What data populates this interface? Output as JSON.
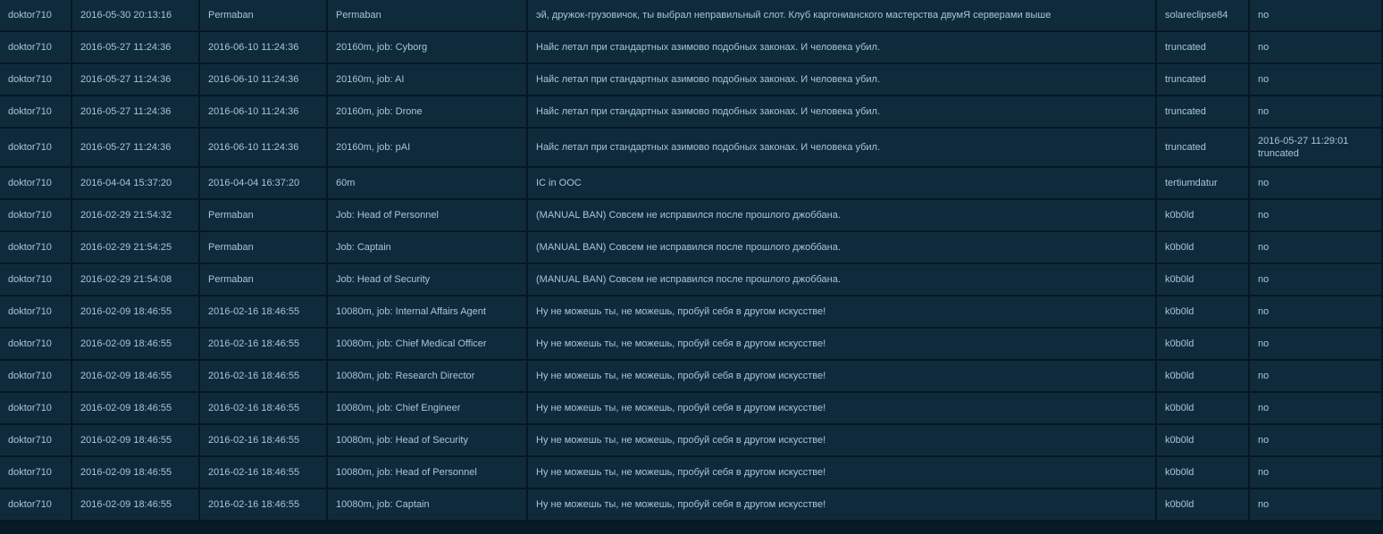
{
  "rows": [
    {
      "ckey": "doktor710",
      "bantime": "2016-05-30 20:13:16",
      "expires": "Permaban",
      "type": "Permaban",
      "reason": "эй, дружок-грузовичок, ты выбрал неправильный слот. Клуб каргонианского мастерства двумЯ серверами выше",
      "admin": "solareclipse84",
      "unbanned": "no"
    },
    {
      "ckey": "doktor710",
      "bantime": "2016-05-27 11:24:36",
      "expires": "2016-06-10 11:24:36",
      "type": "20160m, job: Cyborg",
      "reason": "Найс летал при стандартных азимово подобных законах. И человека убил.",
      "admin": "truncated",
      "unbanned": "no"
    },
    {
      "ckey": "doktor710",
      "bantime": "2016-05-27 11:24:36",
      "expires": "2016-06-10 11:24:36",
      "type": "20160m, job: AI",
      "reason": "Найс летал при стандартных азимово подобных законах. И человека убил.",
      "admin": "truncated",
      "unbanned": "no"
    },
    {
      "ckey": "doktor710",
      "bantime": "2016-05-27 11:24:36",
      "expires": "2016-06-10 11:24:36",
      "type": "20160m, job: Drone",
      "reason": "Найс летал при стандартных азимово подобных законах. И человека убил.",
      "admin": "truncated",
      "unbanned": "no"
    },
    {
      "ckey": "doktor710",
      "bantime": "2016-05-27 11:24:36",
      "expires": "2016-06-10 11:24:36",
      "type": "20160m, job: pAI",
      "reason": "Найс летал при стандартных азимово подобных законах. И человека убил.",
      "admin": "truncated",
      "unbanned": "2016-05-27 11:29:01",
      "unbanned_by": "truncated"
    },
    {
      "ckey": "doktor710",
      "bantime": "2016-04-04 15:37:20",
      "expires": "2016-04-04 16:37:20",
      "type": "60m",
      "reason": "IC in OOC",
      "admin": "tertiumdatur",
      "unbanned": "no"
    },
    {
      "ckey": "doktor710",
      "bantime": "2016-02-29 21:54:32",
      "expires": "Permaban",
      "type": "Job: Head of Personnel",
      "reason": "(MANUAL BAN) Совсем не исправился после прошлого джоббана.",
      "admin": "k0b0ld",
      "unbanned": "no"
    },
    {
      "ckey": "doktor710",
      "bantime": "2016-02-29 21:54:25",
      "expires": "Permaban",
      "type": "Job: Captain",
      "reason": "(MANUAL BAN) Совсем не исправился после прошлого джоббана.",
      "admin": "k0b0ld",
      "unbanned": "no"
    },
    {
      "ckey": "doktor710",
      "bantime": "2016-02-29 21:54:08",
      "expires": "Permaban",
      "type": "Job: Head of Security",
      "reason": "(MANUAL BAN) Совсем не исправился после прошлого джоббана.",
      "admin": "k0b0ld",
      "unbanned": "no"
    },
    {
      "ckey": "doktor710",
      "bantime": "2016-02-09 18:46:55",
      "expires": "2016-02-16 18:46:55",
      "type": "10080m, job: Internal Affairs Agent",
      "reason": "Ну не можешь ты, не можешь, пробуй себя в другом искусстве!",
      "admin": "k0b0ld",
      "unbanned": "no"
    },
    {
      "ckey": "doktor710",
      "bantime": "2016-02-09 18:46:55",
      "expires": "2016-02-16 18:46:55",
      "type": "10080m, job: Chief Medical Officer",
      "reason": "Ну не можешь ты, не можешь, пробуй себя в другом искусстве!",
      "admin": "k0b0ld",
      "unbanned": "no"
    },
    {
      "ckey": "doktor710",
      "bantime": "2016-02-09 18:46:55",
      "expires": "2016-02-16 18:46:55",
      "type": "10080m, job: Research Director",
      "reason": "Ну не можешь ты, не можешь, пробуй себя в другом искусстве!",
      "admin": "k0b0ld",
      "unbanned": "no"
    },
    {
      "ckey": "doktor710",
      "bantime": "2016-02-09 18:46:55",
      "expires": "2016-02-16 18:46:55",
      "type": "10080m, job: Chief Engineer",
      "reason": "Ну не можешь ты, не можешь, пробуй себя в другом искусстве!",
      "admin": "k0b0ld",
      "unbanned": "no"
    },
    {
      "ckey": "doktor710",
      "bantime": "2016-02-09 18:46:55",
      "expires": "2016-02-16 18:46:55",
      "type": "10080m, job: Head of Security",
      "reason": "Ну не можешь ты, не можешь, пробуй себя в другом искусстве!",
      "admin": "k0b0ld",
      "unbanned": "no"
    },
    {
      "ckey": "doktor710",
      "bantime": "2016-02-09 18:46:55",
      "expires": "2016-02-16 18:46:55",
      "type": "10080m, job: Head of Personnel",
      "reason": "Ну не можешь ты, не можешь, пробуй себя в другом искусстве!",
      "admin": "k0b0ld",
      "unbanned": "no"
    },
    {
      "ckey": "doktor710",
      "bantime": "2016-02-09 18:46:55",
      "expires": "2016-02-16 18:46:55",
      "type": "10080m, job: Captain",
      "reason": "Ну не можешь ты, не можешь, пробуй себя в другом искусстве!",
      "admin": "k0b0ld",
      "unbanned": "no"
    }
  ]
}
